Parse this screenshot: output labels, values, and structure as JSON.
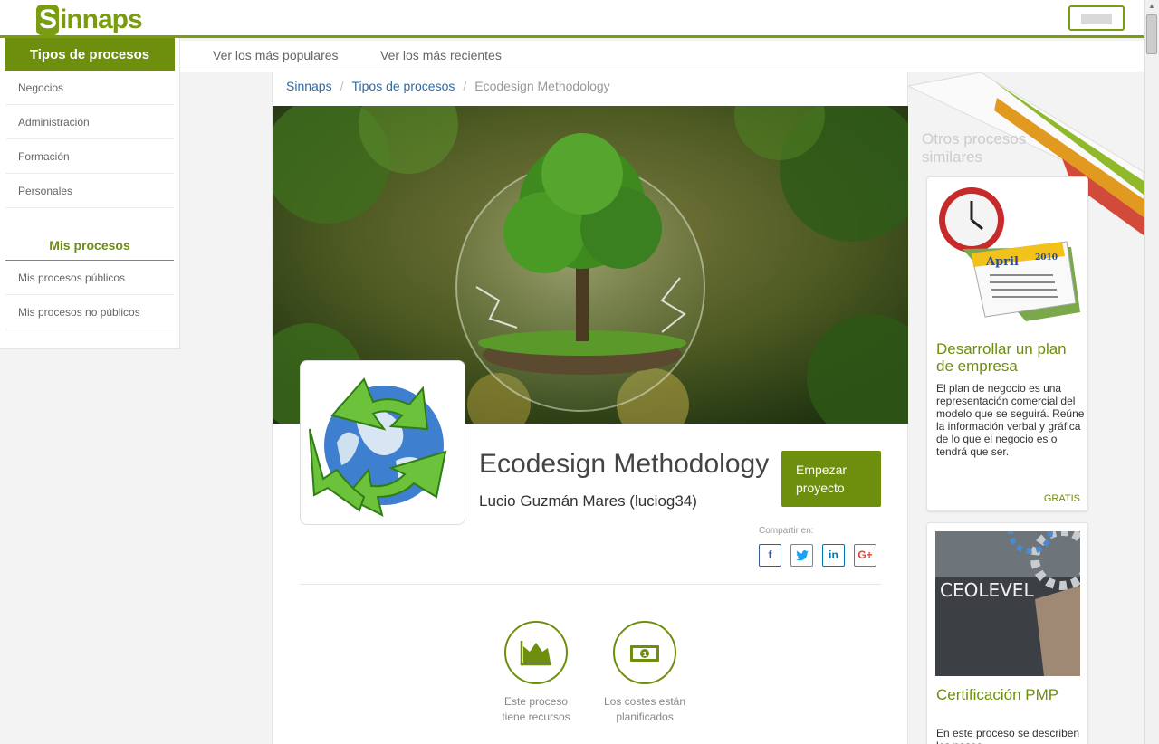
{
  "header": {
    "logo_text": "sinnaps",
    "logo_initial": "S",
    "logo_rest": "innaps"
  },
  "sidebar": {
    "heading": "Tipos de procesos",
    "items": [
      {
        "label": "Negocios"
      },
      {
        "label": "Administración"
      },
      {
        "label": "Formación"
      },
      {
        "label": "Personales"
      }
    ],
    "sub_heading": "Mis procesos",
    "sub_items": [
      {
        "label": "Mis procesos públicos"
      },
      {
        "label": "Mis procesos no públicos"
      }
    ]
  },
  "tabs": [
    {
      "label": "Ver los más populares"
    },
    {
      "label": "Ver los más recientes"
    }
  ],
  "breadcrumb": {
    "items": [
      "Sinnaps",
      "Tipos de procesos",
      "Ecodesign Methodology"
    ],
    "separator": "/"
  },
  "process": {
    "title": "Ecodesign Methodology",
    "author": "Lucio Guzmán Mares (luciog34)",
    "start_label_1": "Empezar",
    "start_label_2": "proyecto",
    "share_label": "Compartir en:",
    "share_buttons": [
      {
        "name": "facebook-icon",
        "glyph": "f"
      },
      {
        "name": "twitter-icon",
        "glyph": "t"
      },
      {
        "name": "linkedin-icon",
        "glyph": "in"
      },
      {
        "name": "googleplus-icon",
        "glyph": "G+"
      }
    ],
    "features": [
      {
        "icon": "area-chart-icon",
        "line1": "Este proceso",
        "line2": "tiene recursos"
      },
      {
        "icon": "money-bill-icon",
        "line1": "Los costes están",
        "line2": "planificados"
      }
    ]
  },
  "similar": {
    "title": "Otros procesos similares",
    "cards": [
      {
        "title": "Desarrollar un plan de empresa",
        "description": "El plan de negocio es una representación comercial del modelo que se seguirá. Reúne la información verbal y gráfica de lo que el negocio es o tendrá que ser.",
        "price": "GRATIS",
        "image": "clock-calendar-image",
        "image_text_month": "April",
        "image_text_year": "2010"
      },
      {
        "title": "Certificación PMP",
        "description": "En este proceso se describen los pasos",
        "image": "ceolevel-gears-image",
        "image_text": "CEOLEVEL"
      }
    ]
  },
  "colors": {
    "brand": "#6e8e0d",
    "link": "#2a6aa8"
  }
}
